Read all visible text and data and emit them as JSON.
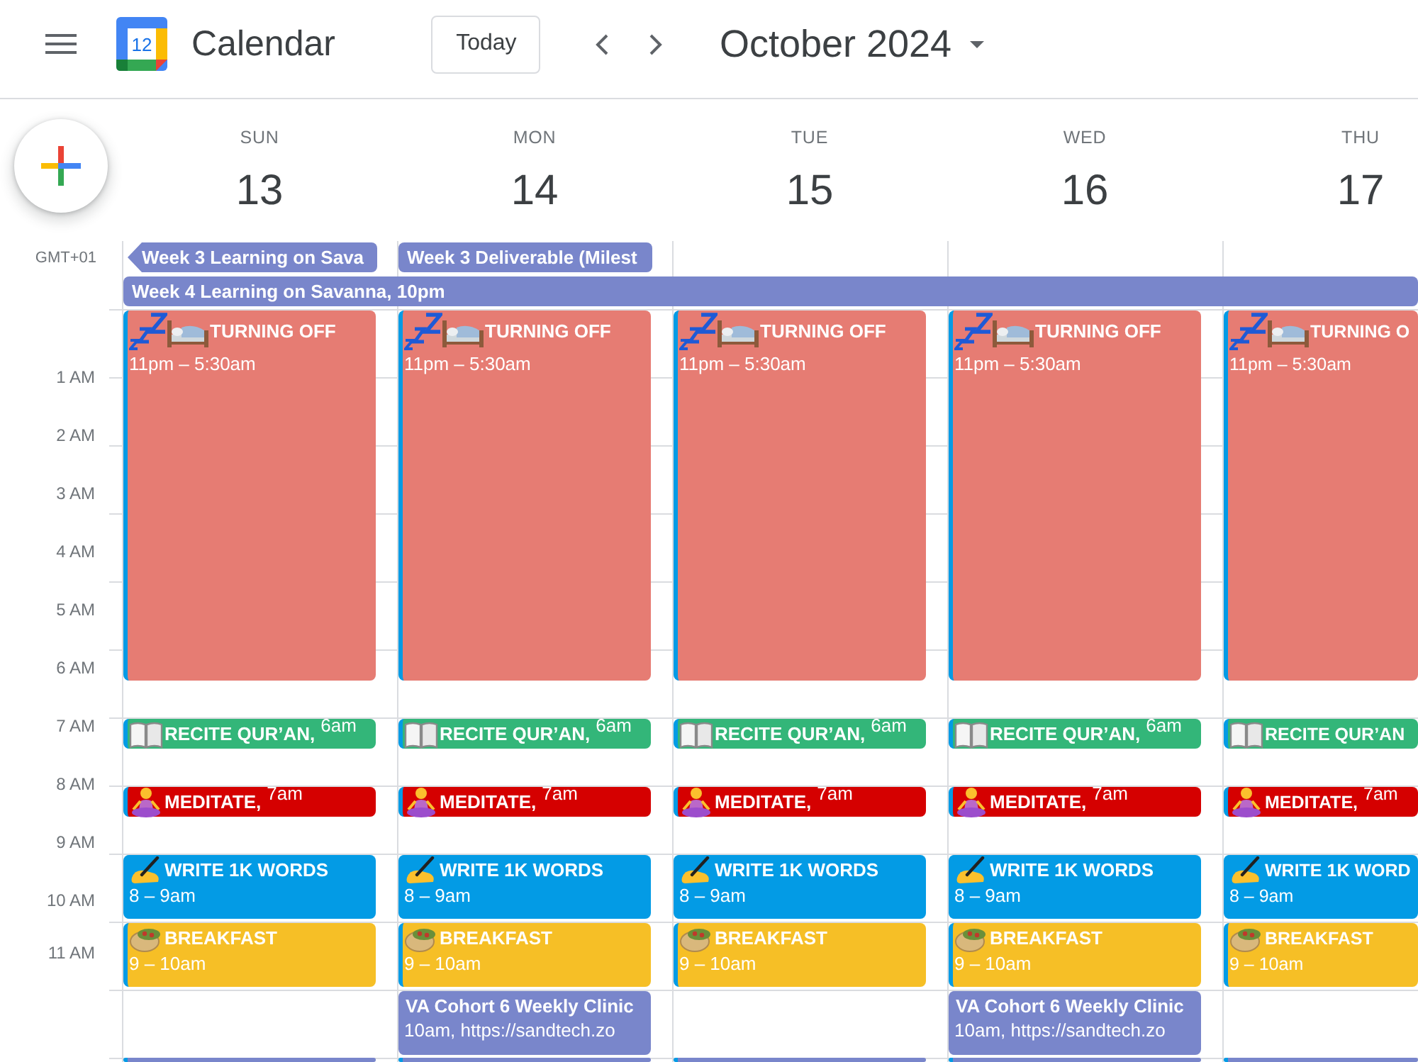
{
  "app": {
    "logo_number": "12",
    "name": "Calendar"
  },
  "toolbar": {
    "today": "Today",
    "period": "October 2024"
  },
  "timezone": "GMT+01",
  "hour_labels": [
    "1 AM",
    "2 AM",
    "3 AM",
    "4 AM",
    "5 AM",
    "6 AM",
    "7 AM",
    "8 AM",
    "9 AM",
    "10 AM",
    "11 AM"
  ],
  "spanning_events": [
    {
      "title": "Week 4 Learning on Savanna, 10pm",
      "color": "#7986cb",
      "continued": false
    }
  ],
  "days": [
    {
      "name": "SUN",
      "date": "13",
      "all_day": [
        {
          "title": "Week 3 Learning on Sava",
          "color": "#7986cb",
          "continued": true
        }
      ],
      "events": [
        {
          "kind": "sleep",
          "title": "TURNING OFF",
          "time": "11pm – 5:30am",
          "color": "#e67c73",
          "stripe": true
        },
        {
          "kind": "reading",
          "title": "RECITE QUR’AN,",
          "time": "6am",
          "color": "#33b679",
          "stripe": true
        },
        {
          "kind": "meditation",
          "title": "MEDITATE,",
          "time": "7am",
          "color": "#d50000",
          "stripe": true
        },
        {
          "kind": "writing",
          "title": "WRITE 1K WORDS",
          "time": "8 – 9am",
          "color": "#039be5"
        },
        {
          "kind": "meal",
          "title": "BREAKFAST",
          "time": "9 – 10am",
          "color": "#f6bf26",
          "stripe": true
        },
        {
          "kind": "cut",
          "color": "#7986cb",
          "stripe": true
        }
      ]
    },
    {
      "name": "MON",
      "date": "14",
      "all_day": [
        {
          "title": "Week 3 Deliverable (Milest",
          "color": "#7986cb",
          "continued": false
        }
      ],
      "events": [
        {
          "kind": "sleep",
          "title": "TURNING OFF",
          "time": "11pm – 5:30am",
          "color": "#e67c73",
          "stripe": true
        },
        {
          "kind": "reading",
          "title": "RECITE QUR’AN,",
          "time": "6am",
          "color": "#33b679",
          "stripe": true
        },
        {
          "kind": "meditation",
          "title": "MEDITATE,",
          "time": "7am",
          "color": "#d50000",
          "stripe": true
        },
        {
          "kind": "writing",
          "title": "WRITE 1K WORDS",
          "time": "8 – 9am",
          "color": "#039be5"
        },
        {
          "kind": "meal",
          "title": "BREAKFAST",
          "time": "9 – 10am",
          "color": "#f6bf26",
          "stripe": true
        },
        {
          "kind": "meeting",
          "title": "VA Cohort 6 Weekly Clinic",
          "time": "10am, https://sandtech.zo",
          "color": "#7986cb",
          "stripe": false
        },
        {
          "kind": "cut",
          "color": "#7986cb",
          "stripe": true
        }
      ]
    },
    {
      "name": "TUE",
      "date": "15",
      "events": [
        {
          "kind": "sleep",
          "title": "TURNING OFF",
          "time": "11pm – 5:30am",
          "color": "#e67c73",
          "stripe": true
        },
        {
          "kind": "reading",
          "title": "RECITE QUR’AN,",
          "time": "6am",
          "color": "#33b679",
          "stripe": true
        },
        {
          "kind": "meditation",
          "title": "MEDITATE,",
          "time": "7am",
          "color": "#d50000",
          "stripe": true
        },
        {
          "kind": "writing",
          "title": "WRITE 1K WORDS",
          "time": "8 – 9am",
          "color": "#039be5"
        },
        {
          "kind": "meal",
          "title": "BREAKFAST",
          "time": "9 – 10am",
          "color": "#f6bf26",
          "stripe": true
        },
        {
          "kind": "cut",
          "color": "#7986cb",
          "stripe": true
        }
      ]
    },
    {
      "name": "WED",
      "date": "16",
      "events": [
        {
          "kind": "sleep",
          "title": "TURNING OFF",
          "time": "11pm – 5:30am",
          "color": "#e67c73",
          "stripe": true
        },
        {
          "kind": "reading",
          "title": "RECITE QUR’AN,",
          "time": "6am",
          "color": "#33b679",
          "stripe": true
        },
        {
          "kind": "meditation",
          "title": "MEDITATE,",
          "time": "7am",
          "color": "#d50000",
          "stripe": true
        },
        {
          "kind": "writing",
          "title": "WRITE 1K WORDS",
          "time": "8 – 9am",
          "color": "#039be5"
        },
        {
          "kind": "meal",
          "title": "BREAKFAST",
          "time": "9 – 10am",
          "color": "#f6bf26",
          "stripe": true
        },
        {
          "kind": "meeting",
          "title": "VA Cohort 6 Weekly Clinic",
          "time": "10am, https://sandtech.zo",
          "color": "#7986cb",
          "stripe": false
        },
        {
          "kind": "cut",
          "color": "#7986cb",
          "stripe": true
        }
      ]
    },
    {
      "name": "THU",
      "date": "17",
      "events": [
        {
          "kind": "sleep",
          "title": "TURNING O",
          "time": "11pm – 5:30am",
          "color": "#e67c73",
          "stripe": true
        },
        {
          "kind": "reading",
          "title": "RECITE QUR’AN",
          "color": "#33b679",
          "stripe": true
        },
        {
          "kind": "meditation",
          "title": "MEDITATE,",
          "time": "7am",
          "color": "#d50000",
          "stripe": true
        },
        {
          "kind": "writing",
          "title": "WRITE 1K WORD",
          "time": "8 – 9am",
          "color": "#039be5"
        },
        {
          "kind": "meal",
          "title": "BREAKFAST",
          "time": "9 – 10am",
          "color": "#f6bf26",
          "stripe": true
        },
        {
          "kind": "cut",
          "color": "#7986cb",
          "stripe": true
        }
      ]
    }
  ]
}
